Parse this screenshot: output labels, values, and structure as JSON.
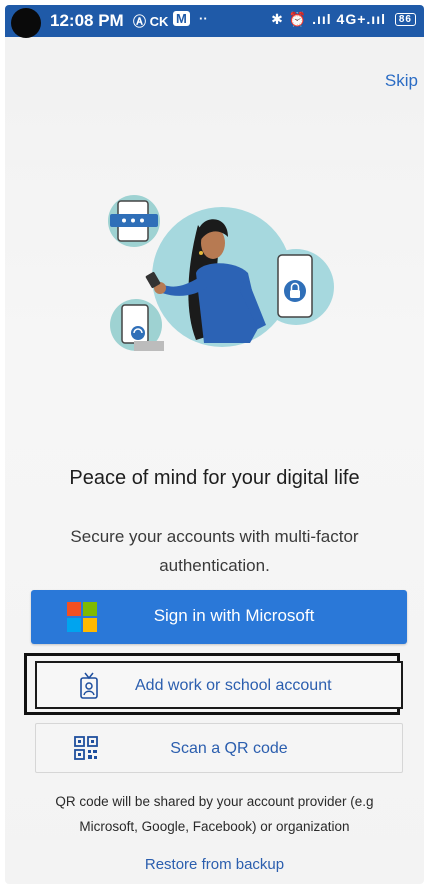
{
  "status_bar": {
    "time": "12:08 PM",
    "left_icons": "Ⓐ CK",
    "m_badge": "M",
    "dots": "··",
    "right_icons": "✱ ⏰ .ııl 4G+.ııl",
    "battery": "86"
  },
  "header": {
    "skip_label": "Skip"
  },
  "hero": {
    "illustration": "woman-with-phone-security-illustration"
  },
  "content": {
    "title": "Peace of mind for your digital life",
    "subtitle": "Secure your accounts with multi-factor authentication."
  },
  "actions": {
    "sign_in_label": "Sign in with Microsoft",
    "add_account_label": "Add work or school account",
    "scan_qr_label": "Scan a QR code",
    "qr_note": "QR code will be shared by your account provider (e.g Microsoft, Google, Facebook) or organization",
    "restore_label": "Restore from backup"
  },
  "colors": {
    "status_bar": "#1f5aa8",
    "primary_button": "#2a78d8",
    "link": "#2b6cc4",
    "ms_red": "#f25022",
    "ms_green": "#7fba00",
    "ms_blue": "#00a4ef",
    "ms_yellow": "#ffb900"
  }
}
